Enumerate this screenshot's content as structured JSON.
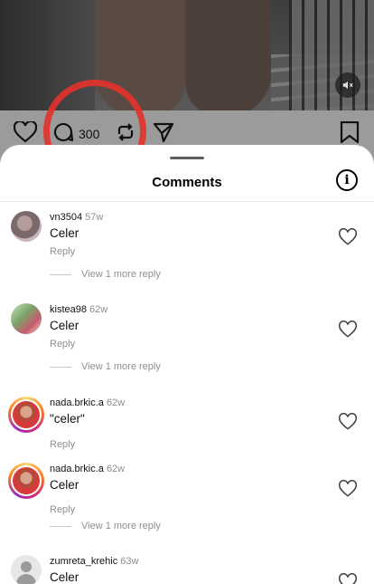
{
  "post": {
    "comment_count": "300"
  },
  "sheet": {
    "title": "Comments",
    "info_glyph": "i"
  },
  "comments": [
    {
      "username": "vn3504",
      "time": "57w",
      "text": "Celer",
      "reply_label": "Reply",
      "more_replies": "View 1 more reply"
    },
    {
      "username": "kistea98",
      "time": "62w",
      "text": "Celer",
      "reply_label": "Reply",
      "more_replies": "View 1 more reply"
    },
    {
      "username": "nada.brkic.a",
      "time": "62w",
      "text": "\"celer\"",
      "reply_label": "Reply"
    },
    {
      "username": "nada.brkic.a",
      "time": "62w",
      "text": "Celer",
      "reply_label": "Reply",
      "more_replies": "View 1 more reply"
    },
    {
      "username": "zumreta_krehic",
      "time": "63w",
      "text": "Celer"
    }
  ],
  "colors": {
    "annotation_circle": "#e4322b",
    "secondary_text": "#8e8e8e"
  },
  "icons": [
    "heart-icon",
    "comment-icon",
    "repost-icon",
    "send-icon",
    "bookmark-icon",
    "mute-icon",
    "info-icon"
  ]
}
